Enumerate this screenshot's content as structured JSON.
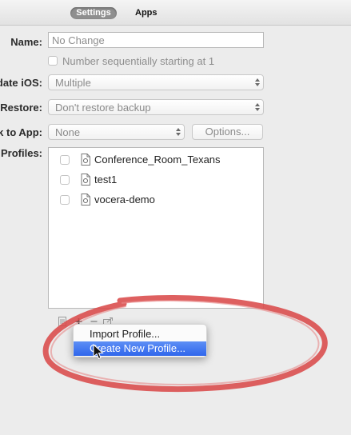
{
  "tabs": {
    "settings": "Settings",
    "apps": "Apps"
  },
  "form": {
    "name_label": "Name:",
    "name_value": "No Change",
    "sequential_label": "Number sequentially starting at 1",
    "update_ios_label": "date iOS:",
    "update_ios_value": "Multiple",
    "restore_label": "Restore:",
    "restore_value": "Don't restore backup",
    "link_app_label": "k to App:",
    "link_app_value": "None",
    "options_button": "Options...",
    "profiles_label": "Profiles:"
  },
  "profiles": [
    {
      "name": "Conference_Room_Texans"
    },
    {
      "name": "test1"
    },
    {
      "name": "vocera-demo"
    }
  ],
  "toolbar": {
    "icons": [
      "settings-icon",
      "plus-icon",
      "minus-icon",
      "share-icon"
    ]
  },
  "context_menu": {
    "items": [
      "Import Profile...",
      "Create New Profile..."
    ],
    "highlighted": "Create New Profile..."
  },
  "annotation": {
    "ring_color": "#d94a4a"
  },
  "colors": {
    "selection": "#2f66ec",
    "border": "#b9b9b9"
  }
}
